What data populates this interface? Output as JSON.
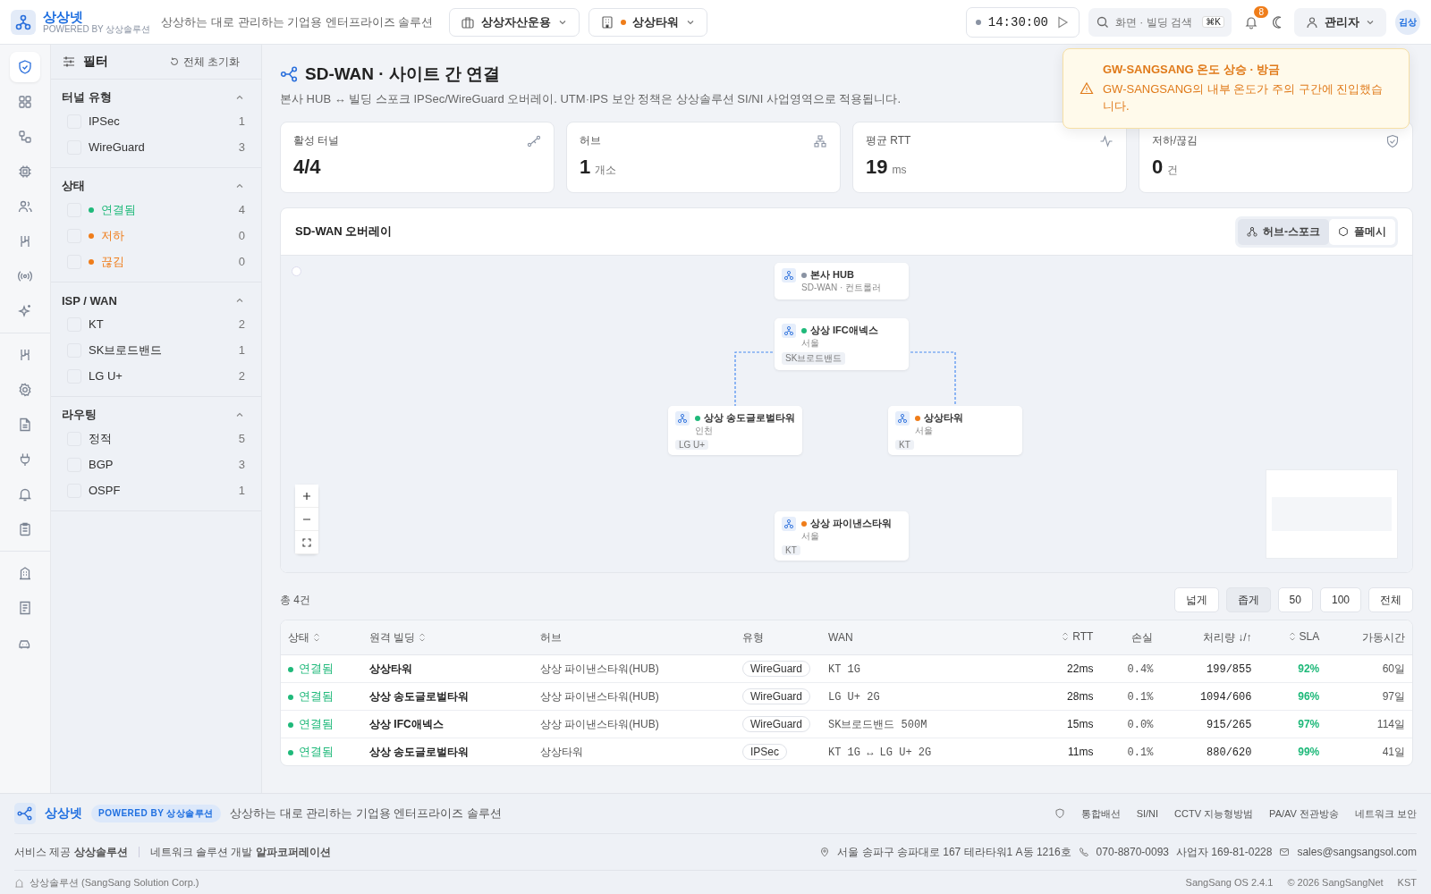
{
  "header": {
    "brand": "상상넷",
    "powered": "POWERED BY 상상솔루션",
    "tagline": "상상하는 대로 관리하는 기업용 엔터프라이즈 솔루션",
    "company": "상상자산운용",
    "building": "상상타워",
    "clock": "14:30:00",
    "search": {
      "placeholder": "화면 · 빌딩 검색",
      "shortcut": "⌘K"
    },
    "notification_count": "8",
    "user": "관리자",
    "avatar": "김상"
  },
  "toast": {
    "title": "GW-SANGSANG 온도 상승 · 방금",
    "message": "GW-SANGSANG의 내부 온도가 주의 구간에 진입했습니다."
  },
  "rail": [
    {
      "selected": true
    },
    {
      "selected": false
    },
    {
      "selected": false
    },
    {
      "selected": false
    },
    {
      "selected": false
    },
    {
      "selected": false
    },
    {
      "selected": false
    },
    {
      "selected": false
    },
    {
      "selected": false
    },
    {
      "selected": false
    },
    {
      "selected": false
    },
    {
      "selected": false
    },
    {
      "selected": false
    },
    {
      "selected": false
    },
    {
      "selected": false
    },
    {
      "selected": false
    },
    {
      "selected": false
    }
  ],
  "filter": {
    "title": "필터",
    "reset": "전체 초기화",
    "groups": [
      {
        "title": "터널 유형",
        "expanded": true,
        "items": [
          {
            "label": "IPSec",
            "count": "1",
            "checked": false
          },
          {
            "label": "WireGuard",
            "count": "3",
            "checked": false
          }
        ]
      },
      {
        "title": "상태",
        "expanded": true,
        "items": [
          {
            "label": "연결됨",
            "count": "4",
            "checked": false,
            "color": "#1fb97a"
          },
          {
            "label": "저하",
            "count": "0",
            "checked": false,
            "color": "#ef7d1a"
          },
          {
            "label": "끊김",
            "count": "0",
            "checked": false,
            "color": "#ef7d1a"
          }
        ]
      },
      {
        "title": "ISP / WAN",
        "expanded": true,
        "items": [
          {
            "label": "KT",
            "count": "2",
            "checked": false
          },
          {
            "label": "SK브로드밴드",
            "count": "1",
            "checked": false
          },
          {
            "label": "LG U+",
            "count": "2",
            "checked": false
          }
        ]
      },
      {
        "title": "라우팅",
        "expanded": true,
        "items": [
          {
            "label": "정적",
            "count": "5",
            "checked": false
          },
          {
            "label": "BGP",
            "count": "3",
            "checked": false
          },
          {
            "label": "OSPF",
            "count": "1",
            "checked": false
          }
        ]
      }
    ]
  },
  "page": {
    "title": "SD-WAN · 사이트 간 연결",
    "subtitle": "본사 HUB ↔ 빌딩 스포크 IPSec/WireGuard 오버레이. UTM·IPS 보안 정책은 상상솔루션 SI/NI 사업영역으로 적용됩니다."
  },
  "stats": [
    {
      "label": "활성 터널",
      "value": "4/4"
    },
    {
      "label": "허브",
      "value": "1",
      "unit": "개소"
    },
    {
      "label": "평균 RTT",
      "value": "19",
      "unit": "ms"
    },
    {
      "label": "저하/끊김",
      "value": "0",
      "unit": "건"
    }
  ],
  "overlay": {
    "title": "SD-WAN 오버레이",
    "modes": [
      {
        "label": "허브-스포크",
        "selected": true
      },
      {
        "label": "풀메시",
        "selected": false
      }
    ],
    "nodes": [
      {
        "name": "본사 HUB",
        "sub": "SD-WAN · 컨트롤러",
        "color": "#8a93a3"
      },
      {
        "name": "상상 IFC애넥스",
        "sub": "서울",
        "tag": "SK브로드밴드",
        "color": "#1fb97a"
      },
      {
        "name": "상상 송도글로벌타워",
        "sub": "인천",
        "tag": "LG U+",
        "color": "#1fb97a"
      },
      {
        "name": "상상타워",
        "sub": "서울",
        "tag": "KT",
        "color": "#ef7d1a"
      },
      {
        "name": "상상 파이낸스타워",
        "sub": "서울",
        "tag": "KT",
        "color": "#ef7d1a"
      }
    ]
  },
  "table": {
    "total": "총 4건",
    "densities": [
      {
        "label": "넓게",
        "selected": false
      },
      {
        "label": "좁게",
        "selected": true
      }
    ],
    "page_sizes": [
      {
        "label": "50",
        "selected": false
      },
      {
        "label": "100",
        "selected": false
      },
      {
        "label": "전체",
        "selected": false
      }
    ],
    "columns": [
      {
        "label": "상태",
        "sortable": true
      },
      {
        "label": "원격 빌딩",
        "sortable": true
      },
      {
        "label": "허브",
        "sortable": false
      },
      {
        "label": "유형",
        "sortable": false
      },
      {
        "label": "WAN",
        "sortable": false
      },
      {
        "label": "RTT",
        "sortable": true
      },
      {
        "label": "손실",
        "sortable": false
      },
      {
        "label": "처리량 ↓/↑",
        "sortable": false
      },
      {
        "label": "SLA",
        "sortable": true
      },
      {
        "label": "가동시간",
        "sortable": false
      }
    ],
    "rows": [
      {
        "status": "연결됨",
        "building": "상상타워",
        "hub": "상상 파이낸스타워(HUB)",
        "type": "WireGuard",
        "wan": "KT 1G",
        "rtt": "22ms",
        "loss": "0.4%",
        "throughput": "199/855",
        "sla": "92%",
        "uptime": "60일"
      },
      {
        "status": "연결됨",
        "building": "상상 송도글로벌타워",
        "hub": "상상 파이낸스타워(HUB)",
        "type": "WireGuard",
        "wan": "LG U+ 2G",
        "rtt": "28ms",
        "loss": "0.1%",
        "throughput": "1094/606",
        "sla": "96%",
        "uptime": "97일"
      },
      {
        "status": "연결됨",
        "building": "상상 IFC애넥스",
        "hub": "상상 파이낸스타워(HUB)",
        "type": "WireGuard",
        "wan": "SK브로드밴드 500M",
        "rtt": "15ms",
        "loss": "0.0%",
        "throughput": "915/265",
        "sla": "97%",
        "uptime": "114일"
      },
      {
        "status": "연결됨",
        "building": "상상 송도글로벌타워",
        "hub": "상상타워",
        "type": "IPSec",
        "wan": "KT 1G ↔ LG U+ 2G",
        "rtt": "11ms",
        "loss": "0.1%",
        "throughput": "880/620",
        "sla": "99%",
        "uptime": "41일"
      }
    ]
  },
  "footer": {
    "brand": "상상넷",
    "badge": "POWERED BY 상상솔루션",
    "tagline": "상상하는 대로 관리하는 기업용 엔터프라이즈 솔루션",
    "links": [
      "통합배선",
      "SI/NI",
      "CCTV 지능형방범",
      "PA/AV 전관방송",
      "네트워크 보안"
    ],
    "provider": "서비스 제공 **상상솔루션**",
    "developer": "네트워크 솔루션 개발 **알파코퍼레이션**",
    "address": "서울 송파구 송파대로 167 테라타워1 A동 1216호",
    "phone": "070-8870-0093",
    "business_no": "사업자 169-81-0228",
    "email": "sales@sangsangsol.com",
    "company": "상상솔루션 (SangSang Solution Corp.)",
    "version": "SangSang OS 2.4.1",
    "copyright": "© 2026 SangSangNet",
    "timezone": "KST"
  }
}
